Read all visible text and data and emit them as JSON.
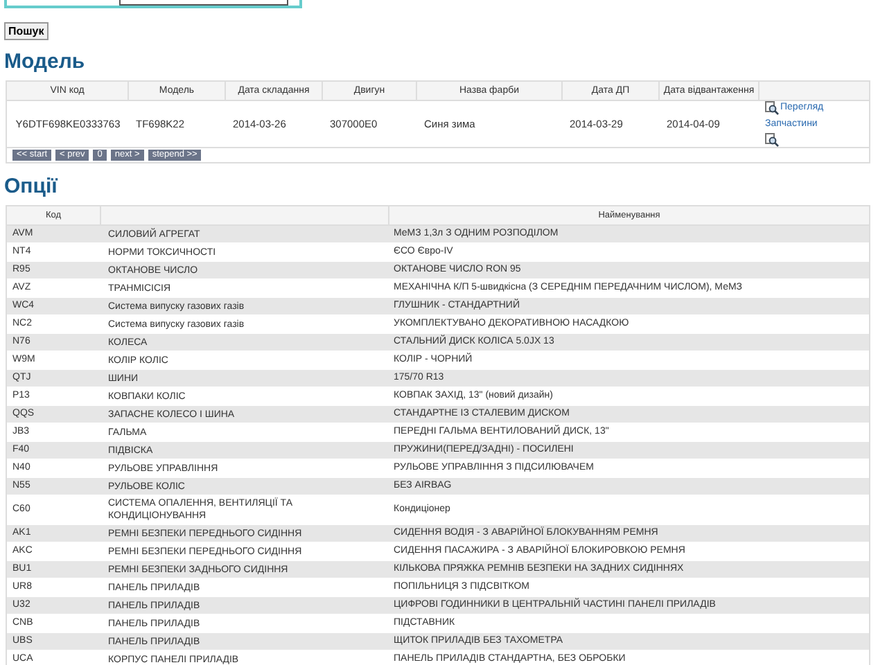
{
  "search": {
    "button": "Пошук"
  },
  "model": {
    "title": "Модель",
    "columns": [
      "VIN код",
      "Модель",
      "Дата складання",
      "Двигун",
      "Назва фарби",
      "Дата ДП",
      "Дата відвантаження"
    ],
    "row": [
      "Y6DTF698KE0333763",
      "TF698K22",
      "2014-03-26",
      "307000E0",
      "Синя зима",
      "2014-03-29",
      "2014-04-09"
    ],
    "links": [
      "Перегляд",
      "Запчастини"
    ],
    "pager": [
      "<< start",
      "< prev",
      "0",
      "next >",
      "stepend >>"
    ]
  },
  "options": {
    "title": "Опції",
    "columns": [
      "Код",
      "Найменування"
    ],
    "rows": [
      {
        "code": "AVM",
        "group": "СИЛОВИЙ АГРЕГАТ",
        "name": "МеМЗ 1,3л З ОДНИМ РОЗПОДІЛОМ"
      },
      {
        "code": "NT4",
        "group": "НОРМИ ТОКСИЧНОСТІ",
        "name": "ЄСО Євро-IV"
      },
      {
        "code": "R95",
        "group": "ОКТАНОВЕ ЧИСЛО",
        "name": "ОКТАНОВЕ ЧИСЛО RON 95"
      },
      {
        "code": "AVZ",
        "group": "ТРАНМІСІСІЯ",
        "name": "МЕХАНІЧНА К/П 5-швидкісна (З СЕРЕДНІМ ПЕРЕДАЧНИМ ЧИСЛОМ), МеМЗ"
      },
      {
        "code": "WC4",
        "group": "Система випуску газових газів",
        "name": "ГЛУШНИК - СТАНДАРТНИЙ"
      },
      {
        "code": "NC2",
        "group": "Система випуску газових газів",
        "name": "УКОМПЛЕКТУВАНО ДЕКОРАТИВНОЮ НАСАДКОЮ"
      },
      {
        "code": "N76",
        "group": "КОЛЕСА",
        "name": "СТАЛЬНИЙ ДИСК КОЛІСА 5.0JX 13"
      },
      {
        "code": "W9M",
        "group": "КОЛІР КОЛІС",
        "name": "КОЛІР - ЧОРНИЙ"
      },
      {
        "code": "QTJ",
        "group": "ШИНИ",
        "name": "175/70 R13"
      },
      {
        "code": "P13",
        "group": "КОВПАКИ КОЛІС",
        "name": "КОВПАК ЗАХІД, 13\" (новий дизайн)"
      },
      {
        "code": "QQS",
        "group": "ЗАПАСНЕ КОЛЕСО І ШИНА",
        "name": "СТАНДАРТНЕ ІЗ СТАЛЕВИМ ДИСКОМ"
      },
      {
        "code": "JB3",
        "group": "ГАЛЬМА",
        "name": "ПЕРЕДНІ ГАЛЬМА ВЕНТИЛОВАНИЙ ДИСК, 13\""
      },
      {
        "code": "F40",
        "group": "ПІДВІСКА",
        "name": "ПРУЖИНИ(ПЕРЕД/ЗАДНІ) - ПОСИЛЕНІ"
      },
      {
        "code": "N40",
        "group": "РУЛЬОВЕ УПРАВЛІННЯ",
        "name": "РУЛЬОВЕ УПРАВЛІННЯ З ПІДСИЛЮВАЧЕМ"
      },
      {
        "code": "N55",
        "group": "РУЛЬОВЕ КОЛІС",
        "name": "БЕЗ AIRBAG"
      },
      {
        "code": "C60",
        "group": "СИСТЕМА ОПАЛЕННЯ, ВЕНТИЛЯЦІЇ ТА КОНДИЦІОНУВАННЯ",
        "name": "Кондиціонер"
      },
      {
        "code": "AK1",
        "group": "РЕМНІ БЕЗПЕКИ ПЕРЕДНЬОГО СИДІННЯ",
        "name": "СИДЕННЯ ВОДІЯ - З АВАРІЙНОЇ БЛОКУВАННЯМ РЕМНЯ"
      },
      {
        "code": "AKC",
        "group": "РЕМНІ БЕЗПЕКИ ПЕРЕДНЬОГО СИДІННЯ",
        "name": "СИДЕННЯ ПАСАЖИРА - З АВАРІЙНОЇ БЛОКИРОВКОЮ РЕМНЯ"
      },
      {
        "code": "BU1",
        "group": "РЕМНІ БЕЗПЕКИ ЗАДНЬОГО СИДІННЯ",
        "name": "КІЛЬКОВА ПРЯЖКА РЕМНІВ БЕЗПЕКИ НА ЗАДНИХ СИДІННЯХ"
      },
      {
        "code": "UR8",
        "group": "ПАНЕЛЬ ПРИЛАДІВ",
        "name": "ПОПІЛЬНИЦЯ З ПІДСВІТКОМ"
      },
      {
        "code": "U32",
        "group": "ПАНЕЛЬ ПРИЛАДІВ",
        "name": "ЦИФРОВІ ГОДИННИКИ В ЦЕНТРАЛЬНІЙ ЧАСТИНІ ПАНЕЛІ ПРИЛАДІВ"
      },
      {
        "code": "CNB",
        "group": "ПАНЕЛЬ ПРИЛАДІВ",
        "name": "ПІДСТАВНИК"
      },
      {
        "code": "UBS",
        "group": "ПАНЕЛЬ ПРИЛАДІВ",
        "name": "ЩИТОК ПРИЛАДІВ БЕЗ ТАХОМЕТРА"
      },
      {
        "code": "UCA",
        "group": "КОРПУС ПАНЕЛІ ПРИЛАДІВ",
        "name": "ПАНЕЛЬ ПРИЛАДІВ СТАНДАРТНА, БЕЗ ОБРОБКИ"
      }
    ]
  }
}
